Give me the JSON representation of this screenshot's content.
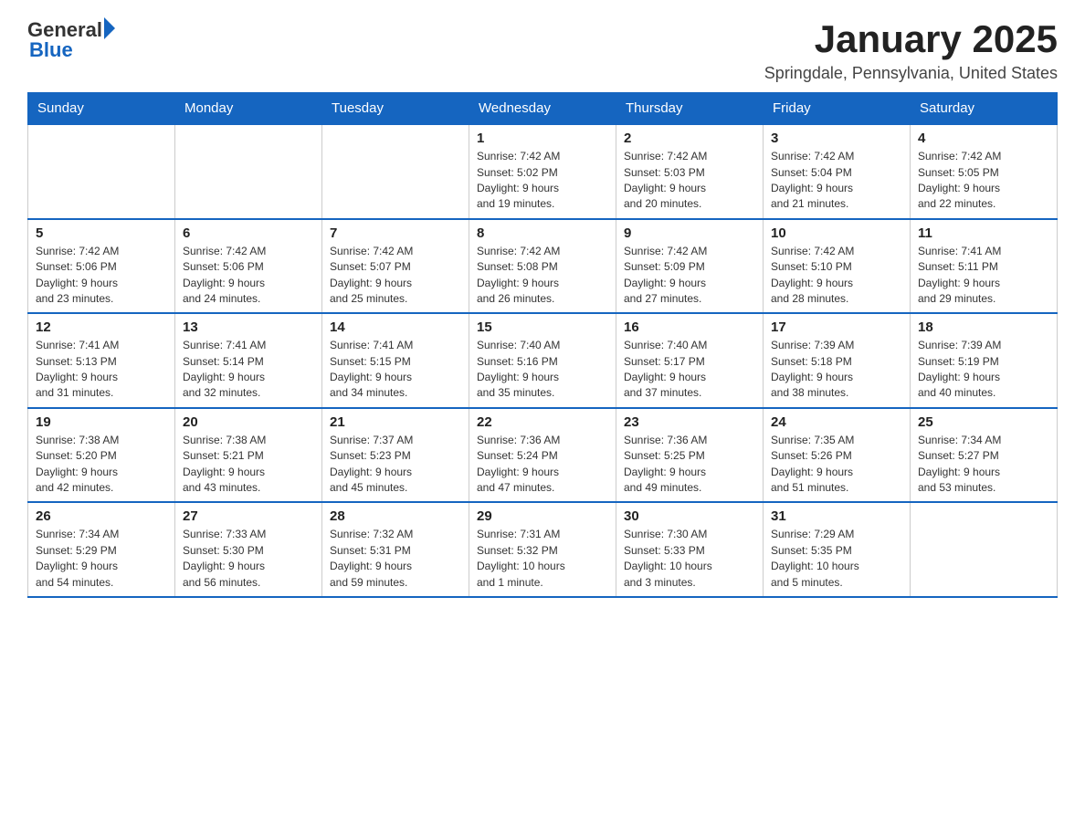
{
  "header": {
    "logo_general": "General",
    "logo_blue": "Blue",
    "month_title": "January 2025",
    "location": "Springdale, Pennsylvania, United States"
  },
  "weekdays": [
    "Sunday",
    "Monday",
    "Tuesday",
    "Wednesday",
    "Thursday",
    "Friday",
    "Saturday"
  ],
  "weeks": [
    [
      {
        "day": "",
        "info": ""
      },
      {
        "day": "",
        "info": ""
      },
      {
        "day": "",
        "info": ""
      },
      {
        "day": "1",
        "info": "Sunrise: 7:42 AM\nSunset: 5:02 PM\nDaylight: 9 hours\nand 19 minutes."
      },
      {
        "day": "2",
        "info": "Sunrise: 7:42 AM\nSunset: 5:03 PM\nDaylight: 9 hours\nand 20 minutes."
      },
      {
        "day": "3",
        "info": "Sunrise: 7:42 AM\nSunset: 5:04 PM\nDaylight: 9 hours\nand 21 minutes."
      },
      {
        "day": "4",
        "info": "Sunrise: 7:42 AM\nSunset: 5:05 PM\nDaylight: 9 hours\nand 22 minutes."
      }
    ],
    [
      {
        "day": "5",
        "info": "Sunrise: 7:42 AM\nSunset: 5:06 PM\nDaylight: 9 hours\nand 23 minutes."
      },
      {
        "day": "6",
        "info": "Sunrise: 7:42 AM\nSunset: 5:06 PM\nDaylight: 9 hours\nand 24 minutes."
      },
      {
        "day": "7",
        "info": "Sunrise: 7:42 AM\nSunset: 5:07 PM\nDaylight: 9 hours\nand 25 minutes."
      },
      {
        "day": "8",
        "info": "Sunrise: 7:42 AM\nSunset: 5:08 PM\nDaylight: 9 hours\nand 26 minutes."
      },
      {
        "day": "9",
        "info": "Sunrise: 7:42 AM\nSunset: 5:09 PM\nDaylight: 9 hours\nand 27 minutes."
      },
      {
        "day": "10",
        "info": "Sunrise: 7:42 AM\nSunset: 5:10 PM\nDaylight: 9 hours\nand 28 minutes."
      },
      {
        "day": "11",
        "info": "Sunrise: 7:41 AM\nSunset: 5:11 PM\nDaylight: 9 hours\nand 29 minutes."
      }
    ],
    [
      {
        "day": "12",
        "info": "Sunrise: 7:41 AM\nSunset: 5:13 PM\nDaylight: 9 hours\nand 31 minutes."
      },
      {
        "day": "13",
        "info": "Sunrise: 7:41 AM\nSunset: 5:14 PM\nDaylight: 9 hours\nand 32 minutes."
      },
      {
        "day": "14",
        "info": "Sunrise: 7:41 AM\nSunset: 5:15 PM\nDaylight: 9 hours\nand 34 minutes."
      },
      {
        "day": "15",
        "info": "Sunrise: 7:40 AM\nSunset: 5:16 PM\nDaylight: 9 hours\nand 35 minutes."
      },
      {
        "day": "16",
        "info": "Sunrise: 7:40 AM\nSunset: 5:17 PM\nDaylight: 9 hours\nand 37 minutes."
      },
      {
        "day": "17",
        "info": "Sunrise: 7:39 AM\nSunset: 5:18 PM\nDaylight: 9 hours\nand 38 minutes."
      },
      {
        "day": "18",
        "info": "Sunrise: 7:39 AM\nSunset: 5:19 PM\nDaylight: 9 hours\nand 40 minutes."
      }
    ],
    [
      {
        "day": "19",
        "info": "Sunrise: 7:38 AM\nSunset: 5:20 PM\nDaylight: 9 hours\nand 42 minutes."
      },
      {
        "day": "20",
        "info": "Sunrise: 7:38 AM\nSunset: 5:21 PM\nDaylight: 9 hours\nand 43 minutes."
      },
      {
        "day": "21",
        "info": "Sunrise: 7:37 AM\nSunset: 5:23 PM\nDaylight: 9 hours\nand 45 minutes."
      },
      {
        "day": "22",
        "info": "Sunrise: 7:36 AM\nSunset: 5:24 PM\nDaylight: 9 hours\nand 47 minutes."
      },
      {
        "day": "23",
        "info": "Sunrise: 7:36 AM\nSunset: 5:25 PM\nDaylight: 9 hours\nand 49 minutes."
      },
      {
        "day": "24",
        "info": "Sunrise: 7:35 AM\nSunset: 5:26 PM\nDaylight: 9 hours\nand 51 minutes."
      },
      {
        "day": "25",
        "info": "Sunrise: 7:34 AM\nSunset: 5:27 PM\nDaylight: 9 hours\nand 53 minutes."
      }
    ],
    [
      {
        "day": "26",
        "info": "Sunrise: 7:34 AM\nSunset: 5:29 PM\nDaylight: 9 hours\nand 54 minutes."
      },
      {
        "day": "27",
        "info": "Sunrise: 7:33 AM\nSunset: 5:30 PM\nDaylight: 9 hours\nand 56 minutes."
      },
      {
        "day": "28",
        "info": "Sunrise: 7:32 AM\nSunset: 5:31 PM\nDaylight: 9 hours\nand 59 minutes."
      },
      {
        "day": "29",
        "info": "Sunrise: 7:31 AM\nSunset: 5:32 PM\nDaylight: 10 hours\nand 1 minute."
      },
      {
        "day": "30",
        "info": "Sunrise: 7:30 AM\nSunset: 5:33 PM\nDaylight: 10 hours\nand 3 minutes."
      },
      {
        "day": "31",
        "info": "Sunrise: 7:29 AM\nSunset: 5:35 PM\nDaylight: 10 hours\nand 5 minutes."
      },
      {
        "day": "",
        "info": ""
      }
    ]
  ]
}
